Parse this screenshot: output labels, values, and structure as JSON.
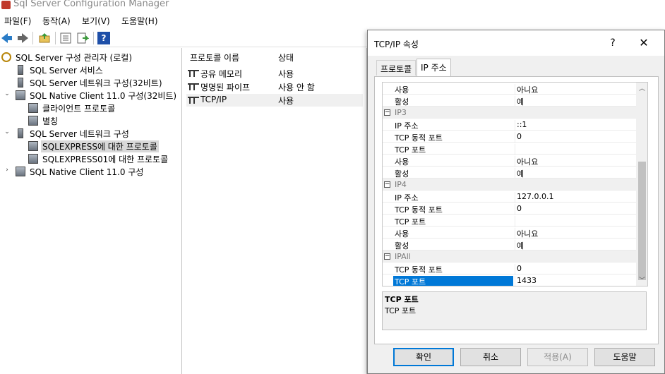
{
  "app": {
    "title": "Sql Server Configuration Manager"
  },
  "menu": [
    {
      "label": "파일(F)"
    },
    {
      "label": "동작(A)"
    },
    {
      "label": "보기(V)"
    },
    {
      "label": "도움말(H)"
    }
  ],
  "toolbar": {
    "icons": [
      "back-icon",
      "forward-icon",
      "up-folder-icon",
      "properties-icon",
      "export-icon",
      "help-icon"
    ],
    "help_glyph": "?"
  },
  "tree": {
    "items": [
      {
        "label": "SQL Server 구성 관리자 (로컬)"
      },
      {
        "label": "SQL Server 서비스"
      },
      {
        "label": "SQL Server 네트워크 구성(32비트)"
      },
      {
        "label": "SQL Native Client 11.0 구성(32비트)"
      },
      {
        "label": "클라이언트 프로토콜"
      },
      {
        "label": "별칭"
      },
      {
        "label": "SQL Server 네트워크 구성"
      },
      {
        "label": "SQLEXPRESS에 대한 프로토콜"
      },
      {
        "label": "SQLEXPRESS01에 대한 프로토콜"
      },
      {
        "label": "SQL Native Client 11.0 구성"
      }
    ],
    "expand_open_glyph": "⌄",
    "expand_closed_glyph": "›"
  },
  "list": {
    "headers": {
      "name": "프로토콜 이름",
      "state": "상태"
    },
    "rows": [
      {
        "name": "공유 메모리",
        "state": "사용"
      },
      {
        "name": "명명된 파이프",
        "state": "사용 안 함"
      },
      {
        "name": "TCP/IP",
        "state": "사용"
      }
    ]
  },
  "dialog": {
    "title": "TCP/IP 속성",
    "help_glyph": "?",
    "close_glyph": "✕",
    "tabs": [
      {
        "label": "프로토콜"
      },
      {
        "label": "IP 주소"
      }
    ],
    "rows": [
      {
        "name": "사용",
        "value": "아니요"
      },
      {
        "name": "활성",
        "value": "예"
      },
      {
        "name": "IP3",
        "value": ""
      },
      {
        "name": "IP 주소",
        "value": "::1"
      },
      {
        "name": "TCP 동적 포트",
        "value": "0"
      },
      {
        "name": "TCP 포트",
        "value": ""
      },
      {
        "name": "사용",
        "value": "아니요"
      },
      {
        "name": "활성",
        "value": "예"
      },
      {
        "name": "IP4",
        "value": ""
      },
      {
        "name": "IP 주소",
        "value": "127.0.0.1"
      },
      {
        "name": "TCP 동적 포트",
        "value": "0"
      },
      {
        "name": "TCP 포트",
        "value": ""
      },
      {
        "name": "사용",
        "value": "아니요"
      },
      {
        "name": "활성",
        "value": "예"
      },
      {
        "name": "IPAll",
        "value": ""
      },
      {
        "name": "TCP 동적 포트",
        "value": "0"
      },
      {
        "name": "TCP 포트",
        "value": "1433"
      }
    ],
    "collapse_glyph": "−",
    "scroll_up_glyph": "︿",
    "scroll_down_glyph": "﹀",
    "description": {
      "title": "TCP 포트",
      "text": "TCP 포트"
    },
    "buttons": {
      "ok": "확인",
      "cancel": "취소",
      "apply": "적용(A)",
      "help": "도움말"
    }
  }
}
